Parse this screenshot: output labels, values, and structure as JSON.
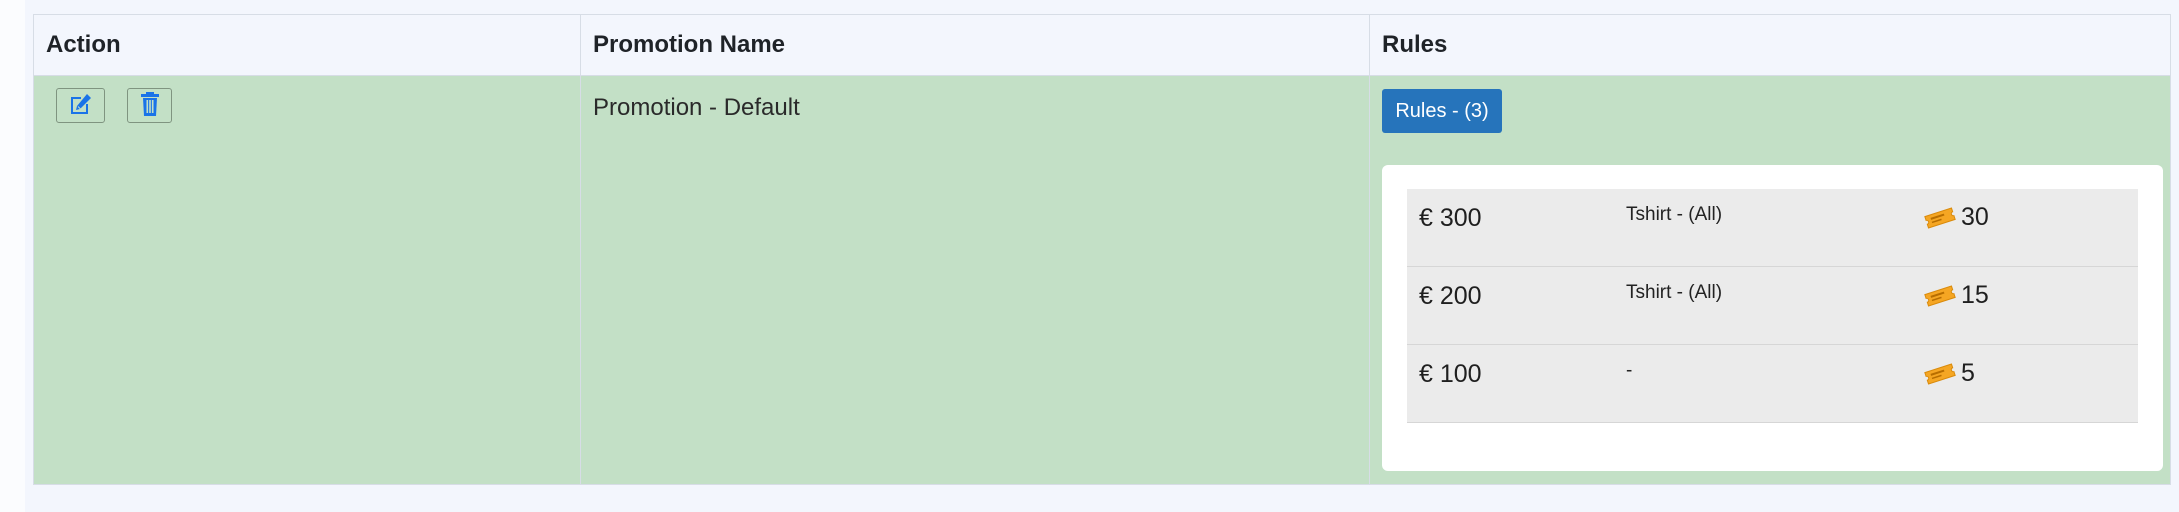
{
  "table": {
    "headers": {
      "action": "Action",
      "promotion_name": "Promotion Name",
      "rules": "Rules"
    },
    "rows": [
      {
        "promotion_name": "Promotion - Default",
        "rules_button_label": "Rules - (3)",
        "rules": [
          {
            "amount": "€ 300",
            "product": "Tshirt - (All)",
            "reward": "30"
          },
          {
            "amount": "€ 200",
            "product": "Tshirt - (All)",
            "reward": "15"
          },
          {
            "amount": "€ 100",
            "product": "-",
            "reward": "5"
          }
        ]
      }
    ]
  },
  "icons": {
    "edit": "edit-icon",
    "delete": "trash-icon",
    "reward": "coupon-icon"
  },
  "colors": {
    "row_background": "#c3e0c6",
    "header_background": "#f3f6fd",
    "accent_button": "#2674bb",
    "icon_blue": "#1a73e8",
    "coupon": "#f5a623"
  }
}
